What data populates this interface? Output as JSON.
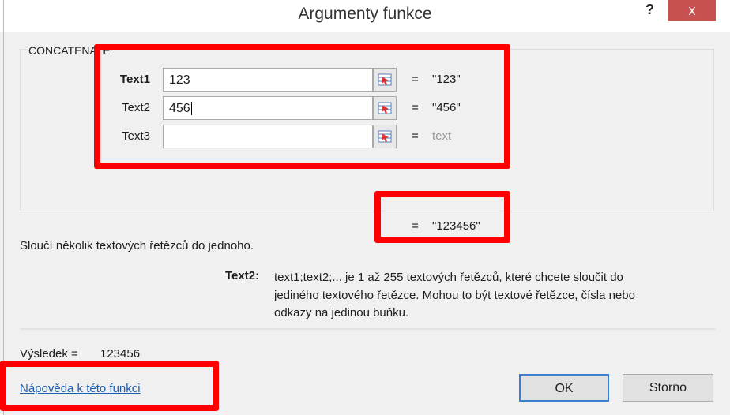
{
  "window": {
    "title": "Argumenty funkce",
    "help_label": "?",
    "close_label": "x"
  },
  "function_name": "CONCATENATE",
  "arguments": [
    {
      "label": "Text1",
      "value": "123",
      "result": "\"123\"",
      "bold": true
    },
    {
      "label": "Text2",
      "value": "456",
      "result": "\"456\"",
      "bold": false
    },
    {
      "label": "Text3",
      "value": "",
      "result": "text",
      "bold": false
    }
  ],
  "equals": "=",
  "formula_result": "\"123456\"",
  "description": "Sloučí několik textových řetězců do jednoho.",
  "arg_help": {
    "label": "Text2:",
    "lines": [
      "text1;text2;... je 1 až 255 textových řetězců, které chcete sloučit do",
      "jediného textového řetězce. Mohou to být textové řetězce, čísla nebo",
      "odkazy na jedinou buňku."
    ]
  },
  "result_line": {
    "label": "Výsledek =",
    "value": "123456"
  },
  "help_link": "Nápověda k této funkci",
  "buttons": {
    "ok": "OK",
    "cancel": "Storno"
  },
  "colors": {
    "highlight": "#ff0000",
    "close": "#c75050",
    "link": "#1a5fb4"
  }
}
